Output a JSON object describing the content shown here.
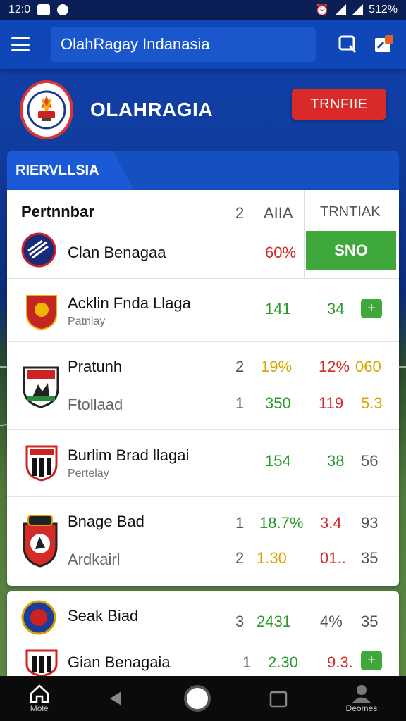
{
  "status_bar": {
    "time": "12:0",
    "battery": "512%"
  },
  "app_bar": {
    "search_text": "OlahRagay Indanasia"
  },
  "header": {
    "brand": "OLAHRAGIA",
    "trend_button": "TRNFIIE"
  },
  "section": {
    "tab_label": "RIERVLLSIA"
  },
  "table": {
    "header_title": "Pertnnbar",
    "header_col_a": "2",
    "header_col_b": "AIIA",
    "header_col_c": "TRNTIAK",
    "rows": [
      {
        "name": "Clan Benagaa",
        "val_a": "60%",
        "action": "SNO"
      },
      {
        "name": "Acklin Fnda Llaga",
        "sub": "Patnlay",
        "val_a": "141",
        "val_b": "34"
      },
      {
        "name": "Pratunh",
        "sub": "Ftollaad",
        "line1": [
          "2",
          "19%",
          "12%",
          "060"
        ],
        "line2": [
          "1",
          "350",
          "119",
          "5.3"
        ]
      },
      {
        "name": "Burlim Brad llagai",
        "sub": "Pertelay",
        "val_a": "154",
        "val_b": "38",
        "val_c": "56"
      },
      {
        "name": "Bnage Bad",
        "sub": "Ardkairl",
        "line1": [
          "1",
          "18.7%",
          "3.4",
          "93"
        ],
        "line2": [
          "2",
          "1.30",
          "01..",
          "35"
        ]
      }
    ]
  },
  "table2": {
    "rows": [
      {
        "name": "Seak Biad",
        "vals": [
          "3",
          "2431",
          "4%",
          "35"
        ]
      },
      {
        "name": "Gian Benagaia",
        "vals": [
          "1",
          "2.30",
          "9.3."
        ]
      }
    ]
  },
  "bottom_nav": {
    "home_label": "Mole",
    "profile_label": "Deomes"
  },
  "colors": {
    "primary": "#0f46b8",
    "accent_red": "#d92a2a",
    "accent_green": "#3ea83a"
  }
}
